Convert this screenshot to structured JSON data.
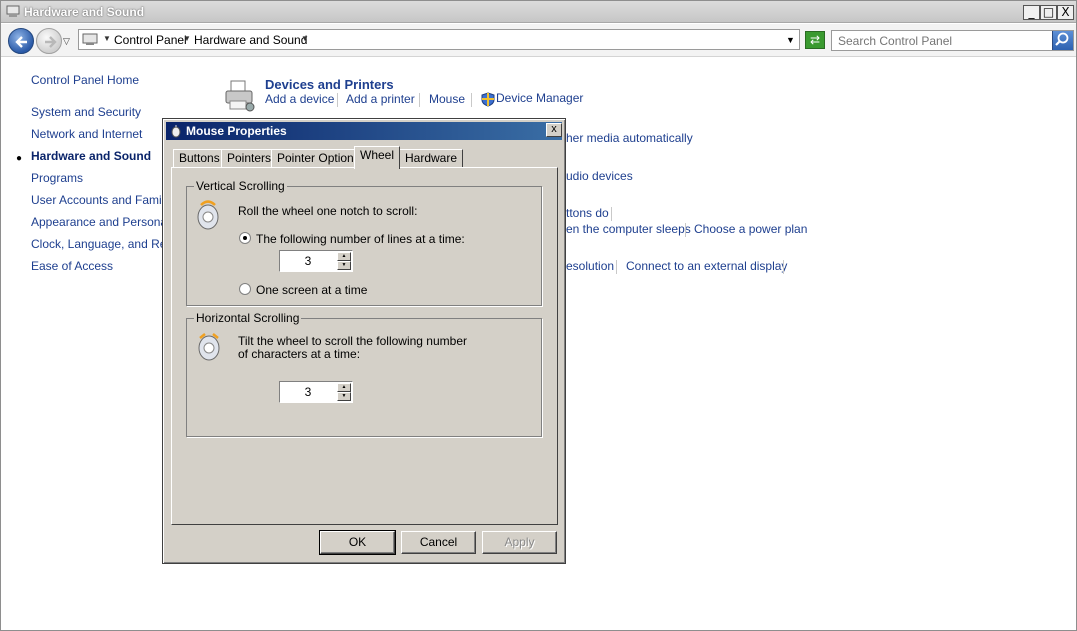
{
  "window": {
    "title": "Hardware and Sound",
    "buttons": {
      "minimize": "_",
      "maximize": "□",
      "close": "X"
    }
  },
  "navbar": {
    "breadcrumb": [
      "Control Panel",
      "Hardware and Sound"
    ],
    "search_placeholder": "Search Control Panel"
  },
  "leftnav": {
    "items": [
      {
        "label": "Control Panel Home"
      },
      {
        "label": "System and Security"
      },
      {
        "label": "Network and Internet"
      },
      {
        "label": "Hardware and Sound",
        "current": true
      },
      {
        "label": "Programs"
      },
      {
        "label": "User Accounts and Family S"
      },
      {
        "label": "Appearance and Personaliz"
      },
      {
        "label": "Clock, Language, and Regi"
      },
      {
        "label": "Ease of Access"
      }
    ]
  },
  "content": {
    "devices_heading": "Devices and Printers",
    "devices_links": [
      "Add a device",
      "Add a printer",
      "Mouse",
      "Device Manager"
    ],
    "autoplay_fragment": "her media automatically",
    "sound_fragment": "udio devices",
    "power_fragment_1": "ttons do",
    "power_fragment_2": "en the computer sleeps",
    "power_plan": "Choose a power plan",
    "display_fragment": "esolution",
    "display_external": "Connect to an external display"
  },
  "dialog": {
    "title": "Mouse Properties",
    "close": "x",
    "tabs": [
      "Buttons",
      "Pointers",
      "Pointer Options",
      "Wheel",
      "Hardware"
    ],
    "active_tab": "Wheel",
    "vertical": {
      "label": "Vertical Scrolling",
      "instruction": "Roll the wheel one notch to scroll:",
      "option_lines": "The following number of lines at a time:",
      "option_screen": "One screen at a time",
      "lines_value": "3",
      "selected": "lines"
    },
    "horizontal": {
      "label": "Horizontal Scrolling",
      "instruction_1": "Tilt the wheel to scroll the following number",
      "instruction_2": "of characters at a time:",
      "chars_value": "3"
    },
    "buttons": {
      "ok": "OK",
      "cancel": "Cancel",
      "apply": "Apply"
    }
  }
}
